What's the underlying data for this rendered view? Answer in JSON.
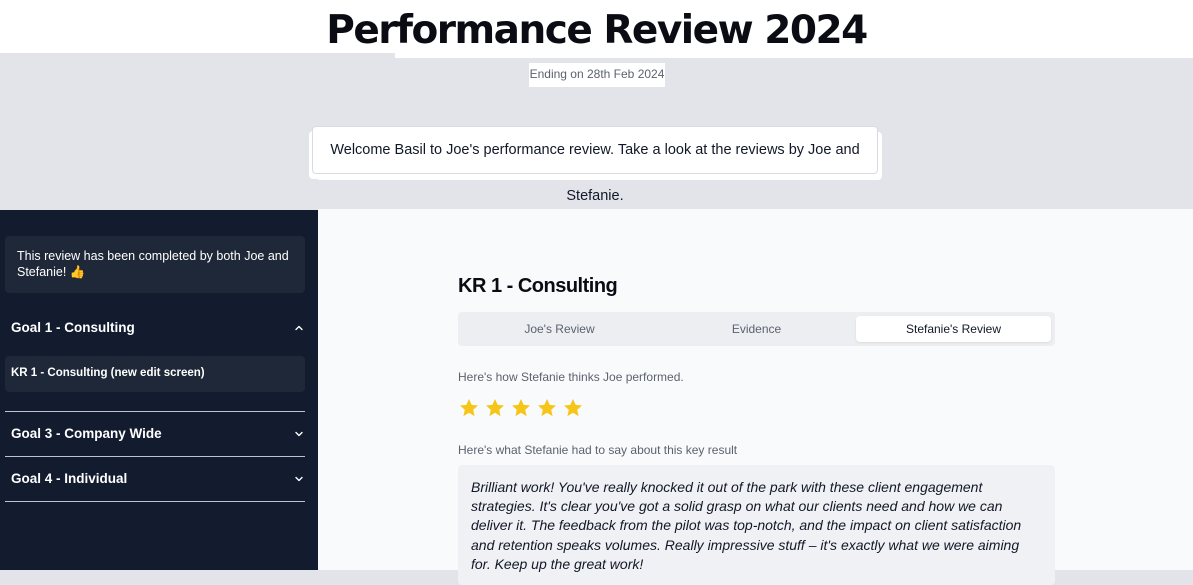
{
  "header": {
    "title": "Performance Review 2024",
    "subtitle": "Ending on 28th Feb 2024",
    "welcome": "Welcome Basil to Joe's performance review. Take a look at the reviews by Joe and Stefanie."
  },
  "sidebar": {
    "completion_note": "This review has been completed by both Joe and Stefanie! 👍",
    "goals": [
      {
        "label": "Goal 1 - Consulting",
        "expanded": true,
        "items": [
          {
            "label": "KR 1 - Consulting (new edit screen)"
          }
        ]
      },
      {
        "label": "Goal 3 - Company Wide",
        "expanded": false
      },
      {
        "label": "Goal 4 - Individual",
        "expanded": false
      }
    ]
  },
  "main": {
    "kr_title": "KR 1 - Consulting",
    "tabs": [
      {
        "label": "Joe's Review",
        "active": false
      },
      {
        "label": "Evidence",
        "active": false
      },
      {
        "label": "Stefanie's Review",
        "active": true
      }
    ],
    "rating_label": "Here's how Stefanie thinks Joe performed.",
    "rating": {
      "value": 5,
      "max": 5
    },
    "comment_label": "Here's what Stefanie had to say about this key result",
    "comment": "Brilliant work! You've really knocked it out of the park with these client engagement strategies. It's clear you've got a solid grasp on what our clients need and how we can deliver it. The feedback from the pilot was top-notch, and the impact on client satisfaction and retention speaks volumes. Really impressive stuff – it's exactly what we were aiming for. Keep up the great work!"
  },
  "colors": {
    "sidebar_bg": "#131b2e",
    "star": "#f5c518",
    "page_bg": "#e2e4ea"
  },
  "icons": [
    "chevron-up-icon",
    "chevron-down-icon",
    "star-icon"
  ]
}
